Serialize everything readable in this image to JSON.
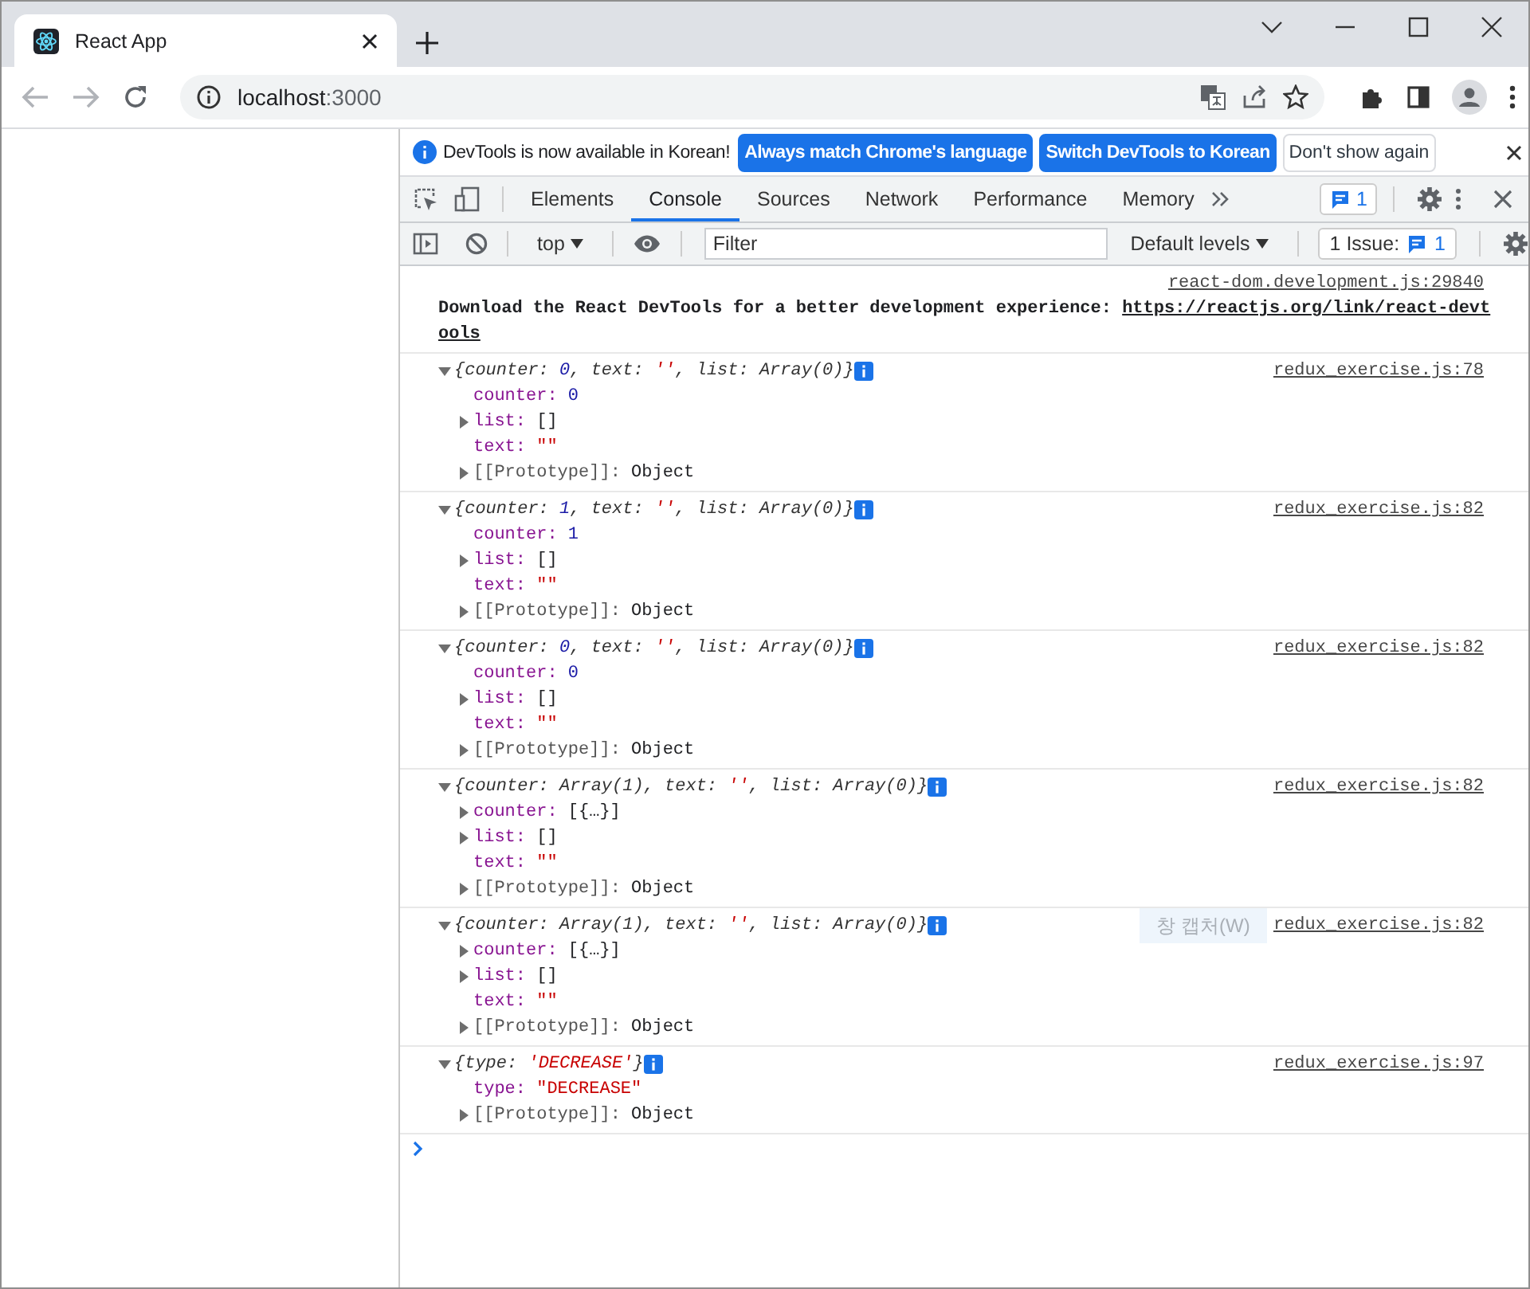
{
  "browser": {
    "tabs": [
      {
        "title": "React App",
        "selected": true
      }
    ],
    "address": {
      "host": "localhost",
      "port": ":3000"
    }
  },
  "devtools": {
    "infobar": {
      "message": "DevTools is now available in Korean!",
      "buttons": [
        {
          "label": "Always match Chrome's language",
          "kind": "primary"
        },
        {
          "label": "Switch DevTools to Korean",
          "kind": "primary"
        },
        {
          "label": "Don't show again",
          "kind": "secondary"
        }
      ]
    },
    "panels": [
      {
        "label": "Elements",
        "selected": false
      },
      {
        "label": "Console",
        "selected": true
      },
      {
        "label": "Sources",
        "selected": false
      },
      {
        "label": "Network",
        "selected": false
      },
      {
        "label": "Performance",
        "selected": false
      },
      {
        "label": "Memory",
        "selected": false
      }
    ],
    "messages_badge": "1",
    "console_toolbar": {
      "context": "top",
      "filter_placeholder": "Filter",
      "levels": "Default levels",
      "issues_label": "1 Issue:",
      "issues_count": "1"
    },
    "messages": [
      {
        "kind": "text",
        "source": "react-dom.development.js:29840",
        "text": "Download the React DevTools for a better development experience: ",
        "link_lines": [
          "https://reactjs.org/link/react-devt",
          "ools"
        ]
      },
      {
        "kind": "object",
        "source": "redux_exercise.js:78",
        "expanded": true,
        "summary": [
          {
            "text": "{counter: ",
            "kind": "plain"
          },
          {
            "text": "0",
            "kind": "number"
          },
          {
            "text": ", text: ",
            "kind": "plain"
          },
          {
            "text": "''",
            "kind": "string"
          },
          {
            "text": ", list: Array(0)}",
            "kind": "plain"
          }
        ],
        "properties": [
          {
            "key": "counter:",
            "value": "0",
            "kind": "number",
            "expandable": false,
            "internal": false
          },
          {
            "key": "list:",
            "value": "[]",
            "kind": "object",
            "expandable": true,
            "internal": false
          },
          {
            "key": "text:",
            "value": "\"\"",
            "kind": "string",
            "expandable": false,
            "internal": false
          },
          {
            "key": "[[Prototype]]:",
            "value": "Object",
            "kind": "object",
            "expandable": true,
            "internal": true
          }
        ]
      },
      {
        "kind": "object",
        "source": "redux_exercise.js:82",
        "expanded": true,
        "summary": [
          {
            "text": "{counter: ",
            "kind": "plain"
          },
          {
            "text": "1",
            "kind": "number"
          },
          {
            "text": ", text: ",
            "kind": "plain"
          },
          {
            "text": "''",
            "kind": "string"
          },
          {
            "text": ", list: Array(0)}",
            "kind": "plain"
          }
        ],
        "properties": [
          {
            "key": "counter:",
            "value": "1",
            "kind": "number",
            "expandable": false,
            "internal": false
          },
          {
            "key": "list:",
            "value": "[]",
            "kind": "object",
            "expandable": true,
            "internal": false
          },
          {
            "key": "text:",
            "value": "\"\"",
            "kind": "string",
            "expandable": false,
            "internal": false
          },
          {
            "key": "[[Prototype]]:",
            "value": "Object",
            "kind": "object",
            "expandable": true,
            "internal": true
          }
        ]
      },
      {
        "kind": "object",
        "source": "redux_exercise.js:82",
        "expanded": true,
        "summary": [
          {
            "text": "{counter: ",
            "kind": "plain"
          },
          {
            "text": "0",
            "kind": "number"
          },
          {
            "text": ", text: ",
            "kind": "plain"
          },
          {
            "text": "''",
            "kind": "string"
          },
          {
            "text": ", list: Array(0)}",
            "kind": "plain"
          }
        ],
        "properties": [
          {
            "key": "counter:",
            "value": "0",
            "kind": "number",
            "expandable": false,
            "internal": false
          },
          {
            "key": "list:",
            "value": "[]",
            "kind": "object",
            "expandable": true,
            "internal": false
          },
          {
            "key": "text:",
            "value": "\"\"",
            "kind": "string",
            "expandable": false,
            "internal": false
          },
          {
            "key": "[[Prototype]]:",
            "value": "Object",
            "kind": "object",
            "expandable": true,
            "internal": true
          }
        ]
      },
      {
        "kind": "object",
        "source": "redux_exercise.js:82",
        "expanded": true,
        "summary": [
          {
            "text": "{counter: Array(1), text: ",
            "kind": "plain"
          },
          {
            "text": "''",
            "kind": "string"
          },
          {
            "text": ", list: Array(0)}",
            "kind": "plain"
          }
        ],
        "properties": [
          {
            "key": "counter:",
            "value": "[{…}]",
            "kind": "object",
            "expandable": true,
            "internal": false
          },
          {
            "key": "list:",
            "value": "[]",
            "kind": "object",
            "expandable": true,
            "internal": false
          },
          {
            "key": "text:",
            "value": "\"\"",
            "kind": "string",
            "expandable": false,
            "internal": false
          },
          {
            "key": "[[Prototype]]:",
            "value": "Object",
            "kind": "object",
            "expandable": true,
            "internal": true
          }
        ]
      },
      {
        "kind": "object",
        "source": "redux_exercise.js:82",
        "expanded": true,
        "summary": [
          {
            "text": "{counter: Array(1), text: ",
            "kind": "plain"
          },
          {
            "text": "''",
            "kind": "string"
          },
          {
            "text": ", list: Array(0)}",
            "kind": "plain"
          }
        ],
        "properties": [
          {
            "key": "counter:",
            "value": "[{…}]",
            "kind": "object",
            "expandable": true,
            "internal": false
          },
          {
            "key": "list:",
            "value": "[]",
            "kind": "object",
            "expandable": true,
            "internal": false
          },
          {
            "key": "text:",
            "value": "\"\"",
            "kind": "string",
            "expandable": false,
            "internal": false
          },
          {
            "key": "[[Prototype]]:",
            "value": "Object",
            "kind": "object",
            "expandable": true,
            "internal": true
          }
        ]
      },
      {
        "kind": "object",
        "source": "redux_exercise.js:97",
        "expanded": true,
        "summary": [
          {
            "text": "{type: ",
            "kind": "plain"
          },
          {
            "text": "'DECREASE'",
            "kind": "string"
          },
          {
            "text": "}",
            "kind": "plain"
          }
        ],
        "properties": [
          {
            "key": "type:",
            "value": "\"DECREASE\"",
            "kind": "string",
            "expandable": false,
            "internal": false
          },
          {
            "key": "[[Prototype]]:",
            "value": "Object",
            "kind": "object",
            "expandable": true,
            "internal": true
          }
        ]
      }
    ]
  },
  "tooltip": "창 캡처(W)"
}
